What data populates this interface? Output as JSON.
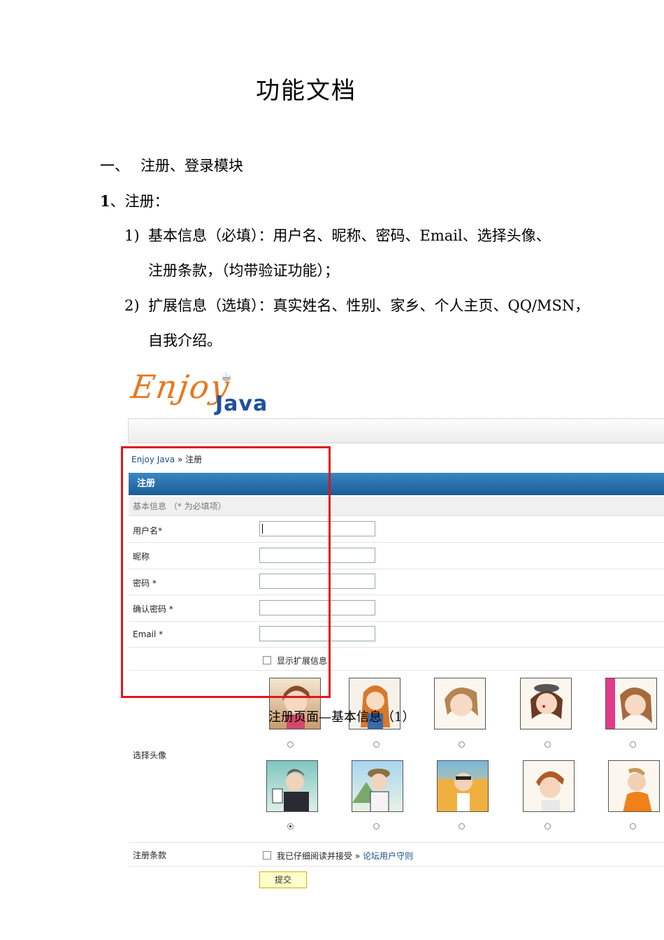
{
  "doc": {
    "title": "功能文档",
    "section_num": "一、",
    "section_title": "注册、登录模块",
    "sub_num": "1",
    "sub_title": "、注册：",
    "item1_num": "1)",
    "item1_line1": "基本信息（必填）：用户名、昵称、密码、Email、选择头像、",
    "item1_line2": "注册条款，（均带验证功能）；",
    "item2_num": "2)",
    "item2_line1": "扩展信息（选填）：真实姓名、性别、家乡、个人主页、QQ/MSN，",
    "item2_line2": "自我介绍。",
    "caption": "注册页面—基本信息（1）"
  },
  "screenshot": {
    "logo_enjoy": "Enjoy",
    "logo_java": "Java",
    "breadcrumb_link": "Enjoy Java",
    "breadcrumb_sep": "»",
    "breadcrumb_current": "注册",
    "header": "注册",
    "subhead": "基本信息 （* 为必填项）",
    "fields": {
      "username": "用户名*",
      "nickname": "昵称",
      "password": "密码 *",
      "confirm": "确认密码 *",
      "email": "Email *"
    },
    "show_ext": "显示扩展信息",
    "avatar_label": "选择头像",
    "terms_label": "注册条款",
    "terms_text": "我已仔细阅读并接受",
    "terms_sep": "»",
    "terms_link": "论坛用户守则",
    "submit": "提交",
    "selected_avatar_index": 5,
    "colors": {
      "header_blue": "#1a5c95",
      "red_box": "#e0161b",
      "logo_orange": "#e8771e",
      "logo_blue": "#1f4fa0"
    }
  }
}
